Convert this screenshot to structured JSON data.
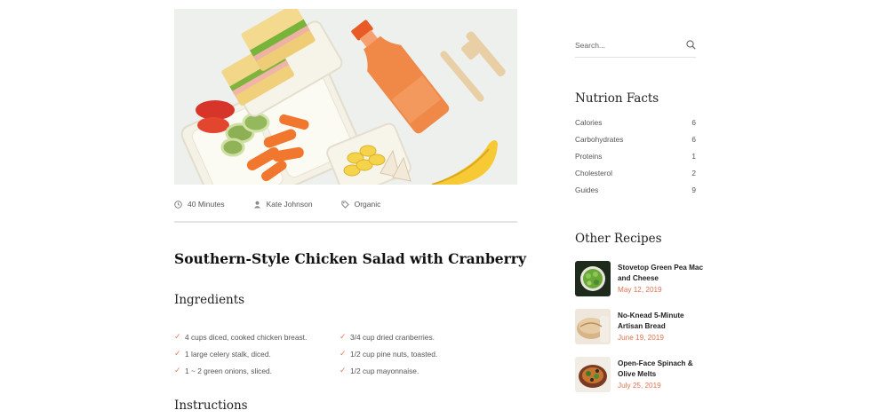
{
  "post": {
    "meta": {
      "time": "40 Minutes",
      "author": "Kate Johnson",
      "tag": "Organic"
    },
    "title": "Southern-Style Chicken Salad with Cranberry",
    "ingredients_heading": "Ingredients",
    "ingredients_left": [
      "4 cups diced, cooked chicken breast.",
      "1 large celery stalk, diced.",
      "1 ~ 2 green onions, sliced."
    ],
    "ingredients_right": [
      "3/4 cup dried cranberries.",
      "1/2 cup pine nuts, toasted.",
      "1/2 cup mayonnaise."
    ],
    "instructions_heading": "Instructions"
  },
  "sidebar": {
    "search_placeholder": "Search...",
    "facts_heading": "Nutrion Facts",
    "facts": [
      {
        "label": "Calories",
        "count": "6"
      },
      {
        "label": "Carbohydrates",
        "count": "6"
      },
      {
        "label": "Proteins",
        "count": "1"
      },
      {
        "label": "Cholesterol",
        "count": "2"
      },
      {
        "label": "Guides",
        "count": "9"
      }
    ],
    "recipes_heading": "Other Recipes",
    "recipes": [
      {
        "title": "Stovetop Green Pea Mac and Cheese",
        "date": "May 12, 2019"
      },
      {
        "title": "No-Knead 5-Minute Artisan Bread",
        "date": "June 19, 2019"
      },
      {
        "title": "Open-Face Spinach & Olive Melts",
        "date": "July 25, 2019"
      }
    ]
  },
  "colors": {
    "accent": "#e0704e",
    "check": "#e8785a",
    "rule": "#e3e3e3"
  },
  "icons": [
    "clock-icon",
    "user-icon",
    "tag-icon",
    "check-icon",
    "search-icon"
  ]
}
